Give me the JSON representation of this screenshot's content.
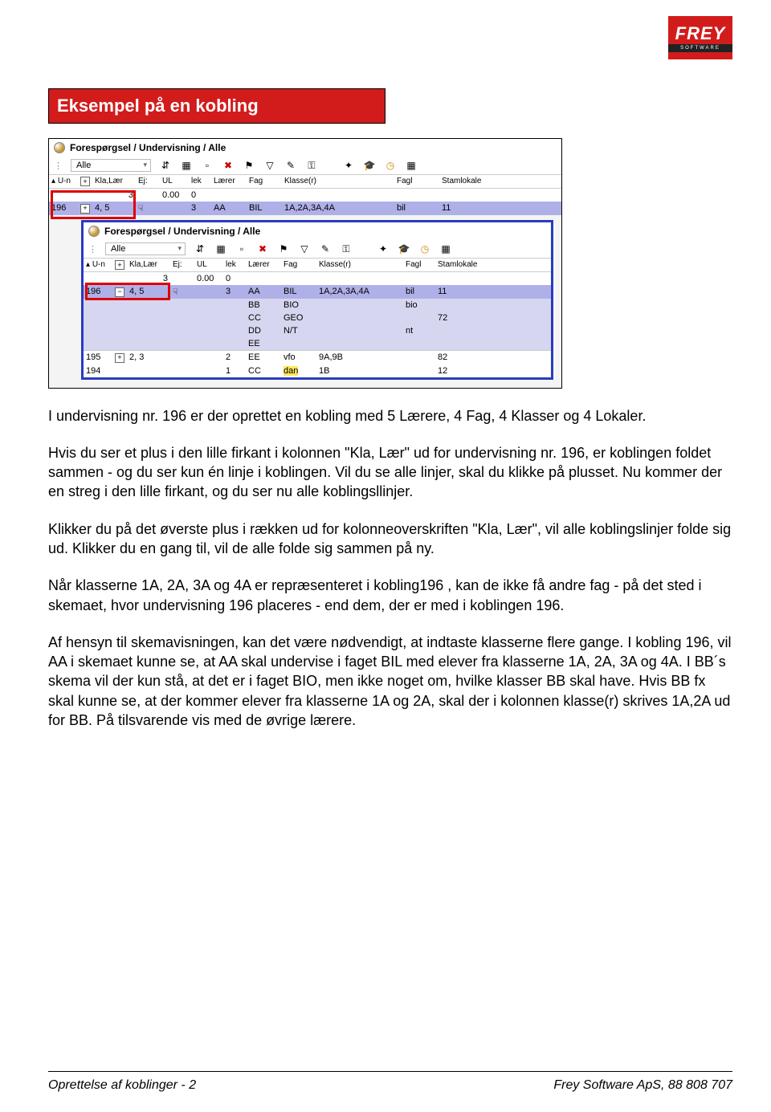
{
  "logo": {
    "word": "FREY",
    "sub": "SOFTWARE"
  },
  "banner": "Eksempel på en kobling",
  "winTitle": "Forespørgsel / Undervisning / Alle",
  "combo": "Alle",
  "headers": {
    "un": "U-n",
    "kla": "Kla,Lær",
    "ej": "Ej:",
    "ul": "UL",
    "lek": "lek",
    "laerer": "Lærer",
    "fag": "Fag",
    "klasser": "Klasse(r)",
    "fagl": "Fagl",
    "stam": "Stamlokale"
  },
  "topRows": {
    "blank": {
      "n": "",
      "val": "3",
      "ul": "0.00",
      "lek": "0"
    },
    "selected": {
      "n": "196",
      "kla": "4, 5",
      "lek": "3",
      "laerer": "AA",
      "fag": "BIL",
      "klasser": "1A,2A,3A,4A",
      "fagl": "bil",
      "stam": "11"
    }
  },
  "inner": {
    "blank": {
      "n": "",
      "val": "3",
      "ul": "0.00",
      "lek": "0"
    },
    "main": {
      "n": "196",
      "kla": "4, 5",
      "lek": "3",
      "laerer": "AA",
      "fag": "BIL",
      "klasser": "1A,2A,3A,4A",
      "fagl": "bil",
      "stam": "11"
    },
    "subs": [
      {
        "laerer": "BB",
        "fag": "BIO",
        "fagl": "bio",
        "stam": ""
      },
      {
        "laerer": "CC",
        "fag": "GEO",
        "fagl": "",
        "stam": "72"
      },
      {
        "laerer": "DD",
        "fag": "N/T",
        "fagl": "nt",
        "stam": ""
      },
      {
        "laerer": "EE",
        "fag": "",
        "fagl": "",
        "stam": ""
      }
    ],
    "extras": [
      {
        "n": "195",
        "kla": "2, 3",
        "lek": "2",
        "laerer": "EE",
        "fag": "vfo",
        "klasser": "9A,9B",
        "fagl": "",
        "stam": "82"
      },
      {
        "n": "194",
        "kla": "",
        "lek": "1",
        "laerer": "CC",
        "fag": "dan",
        "klasser": "1B",
        "fagl": "",
        "stam": "12"
      }
    ]
  },
  "body": {
    "p1": "I undervisning nr. 196 er der oprettet en kobling med 5 Lærere, 4 Fag, 4 Klasser og 4 Lokaler.",
    "p2": "Hvis du ser et plus i den lille firkant i kolonnen \"Kla, Lær\" ud for undervisning nr. 196, er koblingen foldet sammen - og du ser kun én linje i koblingen. Vil du se alle linjer, skal du klikke på plusset. Nu kommer der en streg i den lille firkant, og du ser nu alle koblingsllinjer.",
    "p3": "Klikker du på det øverste plus i rækken ud for kolonneoverskriften \"Kla, Lær\", vil alle koblingslinjer folde sig ud. Klikker du en gang til, vil de alle folde sig sammen på ny.",
    "p4": "Når klasserne 1A, 2A, 3A og 4A er repræsenteret i kobling196 , kan de ikke få andre fag - på det sted i skemaet, hvor undervisning 196 placeres - end dem, der er med i koblingen 196.",
    "p5": "Af hensyn til skemavisningen, kan det være nødvendigt, at indtaste klasserne flere gange. I kobling 196, vil AA i skemaet kunne se, at AA skal undervise i faget BIL med elever fra klasserne 1A, 2A, 3A og 4A. I BB´s skema vil der kun stå, at det er i faget BIO, men ikke noget om, hvilke klasser BB skal have. Hvis BB fx skal kunne se, at der kommer elever fra klasserne 1A og 2A, skal der i kolonnen klasse(r) skrives 1A,2A ud for BB. På tilsvarende vis med de øvrige lærere."
  },
  "footer": {
    "left": "Oprettelse af koblinger - 2",
    "right": "Frey Software ApS, 88 808 707"
  },
  "icons": {
    "x": "✖",
    "filter": "▽",
    "wand": "✎",
    "key": "⚿",
    "grad": "🎓",
    "clock": "◷",
    "cal": "▦",
    "spark": "✦"
  }
}
